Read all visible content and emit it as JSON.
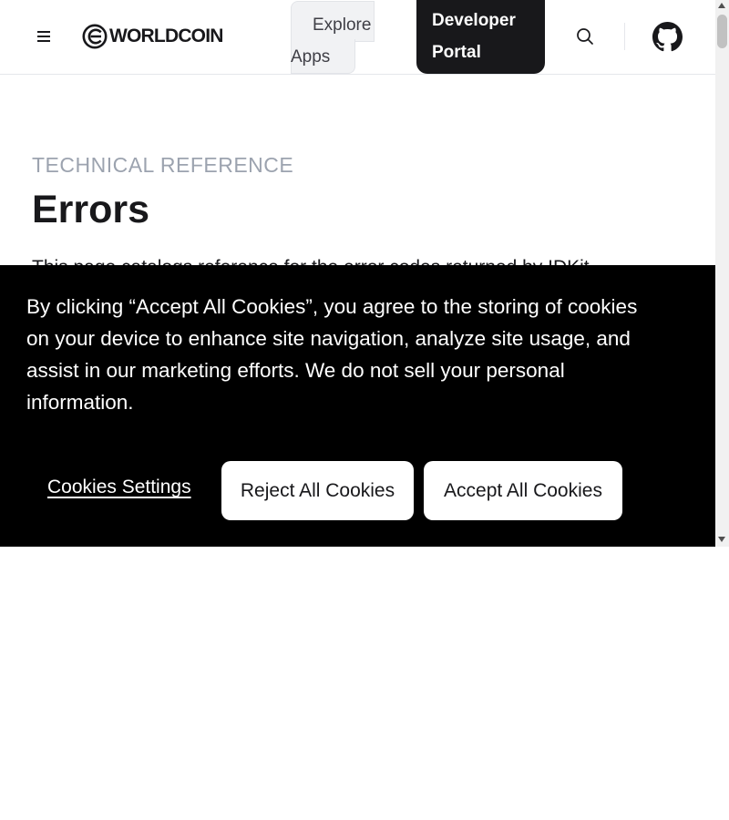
{
  "header": {
    "logo_text": "WORLDCOIN",
    "explore_label": "Explore Apps",
    "developer_portal_label": "Developer Portal",
    "icons": [
      "menu-icon",
      "worldcoin-logo-icon",
      "search-icon",
      "github-icon"
    ]
  },
  "page": {
    "eyebrow": "TECHNICAL REFERENCE",
    "title": "Errors",
    "intro_partial": "This page catalogs reference for the error codes returned by IDKit"
  },
  "cookie_banner": {
    "text": "By clicking “Accept All Cookies”, you agree to the storing of cookies on your device to enhance site navigation, analyze site usage, and assist in our marketing efforts. We do not sell your personal information.",
    "settings_label": "Cookies Settings",
    "reject_label": "Reject All Cookies",
    "accept_label": "Accept All Cookies"
  },
  "colors": {
    "dark": "#18181b",
    "banner_bg": "#000000",
    "muted": "#9ca3af"
  }
}
